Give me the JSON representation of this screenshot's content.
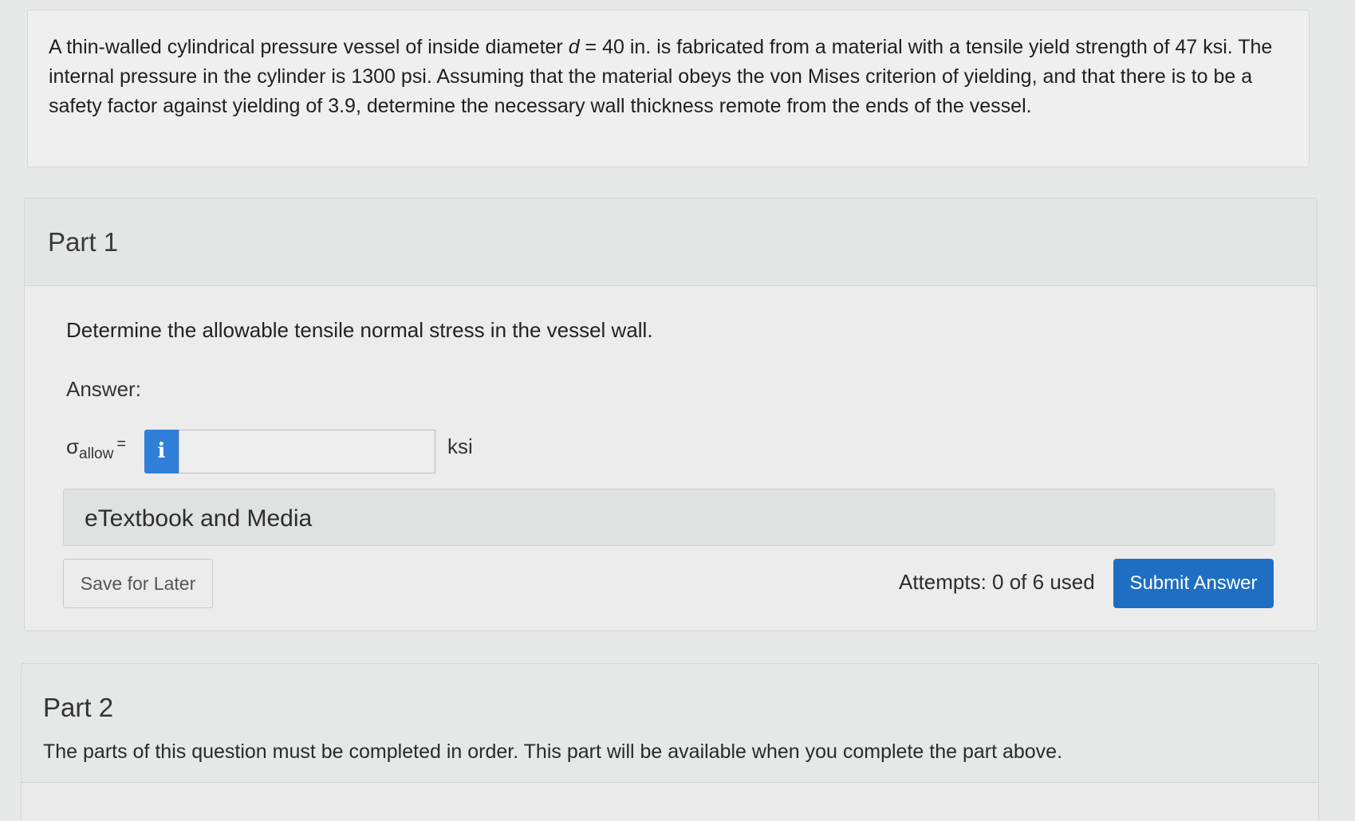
{
  "problem": {
    "text_before_var": "A thin-walled cylindrical pressure vessel of inside diameter ",
    "var_name": "d",
    "text_after_var": " = 40 in. is fabricated from a material with a tensile yield strength of 47 ksi. The internal pressure in the cylinder is 1300 psi. Assuming that the material obeys the von Mises criterion of yielding, and that there is to be a safety factor against yielding of 3.9, determine the necessary wall thickness remote from the ends of the vessel."
  },
  "part1": {
    "title": "Part 1",
    "prompt": "Determine the allowable tensile normal stress in the vessel wall.",
    "answer_label": "Answer:",
    "symbol": "σ",
    "symbol_subscript": "allow",
    "equals": "=",
    "info_glyph": "i",
    "input_value": "",
    "unit": "ksi",
    "etextbook_label": "eTextbook and Media",
    "save_label": "Save for Later",
    "attempts_text": "Attempts: 0 of 6 used",
    "submit_label": "Submit Answer"
  },
  "part2": {
    "title": "Part 2",
    "note": "The parts of this question must be completed in order. This part will be available when you complete the part above."
  },
  "colors": {
    "accent_blue": "#1e6fc4",
    "info_blue": "#2f7ed8"
  },
  "icons": {
    "info": "info-icon"
  }
}
